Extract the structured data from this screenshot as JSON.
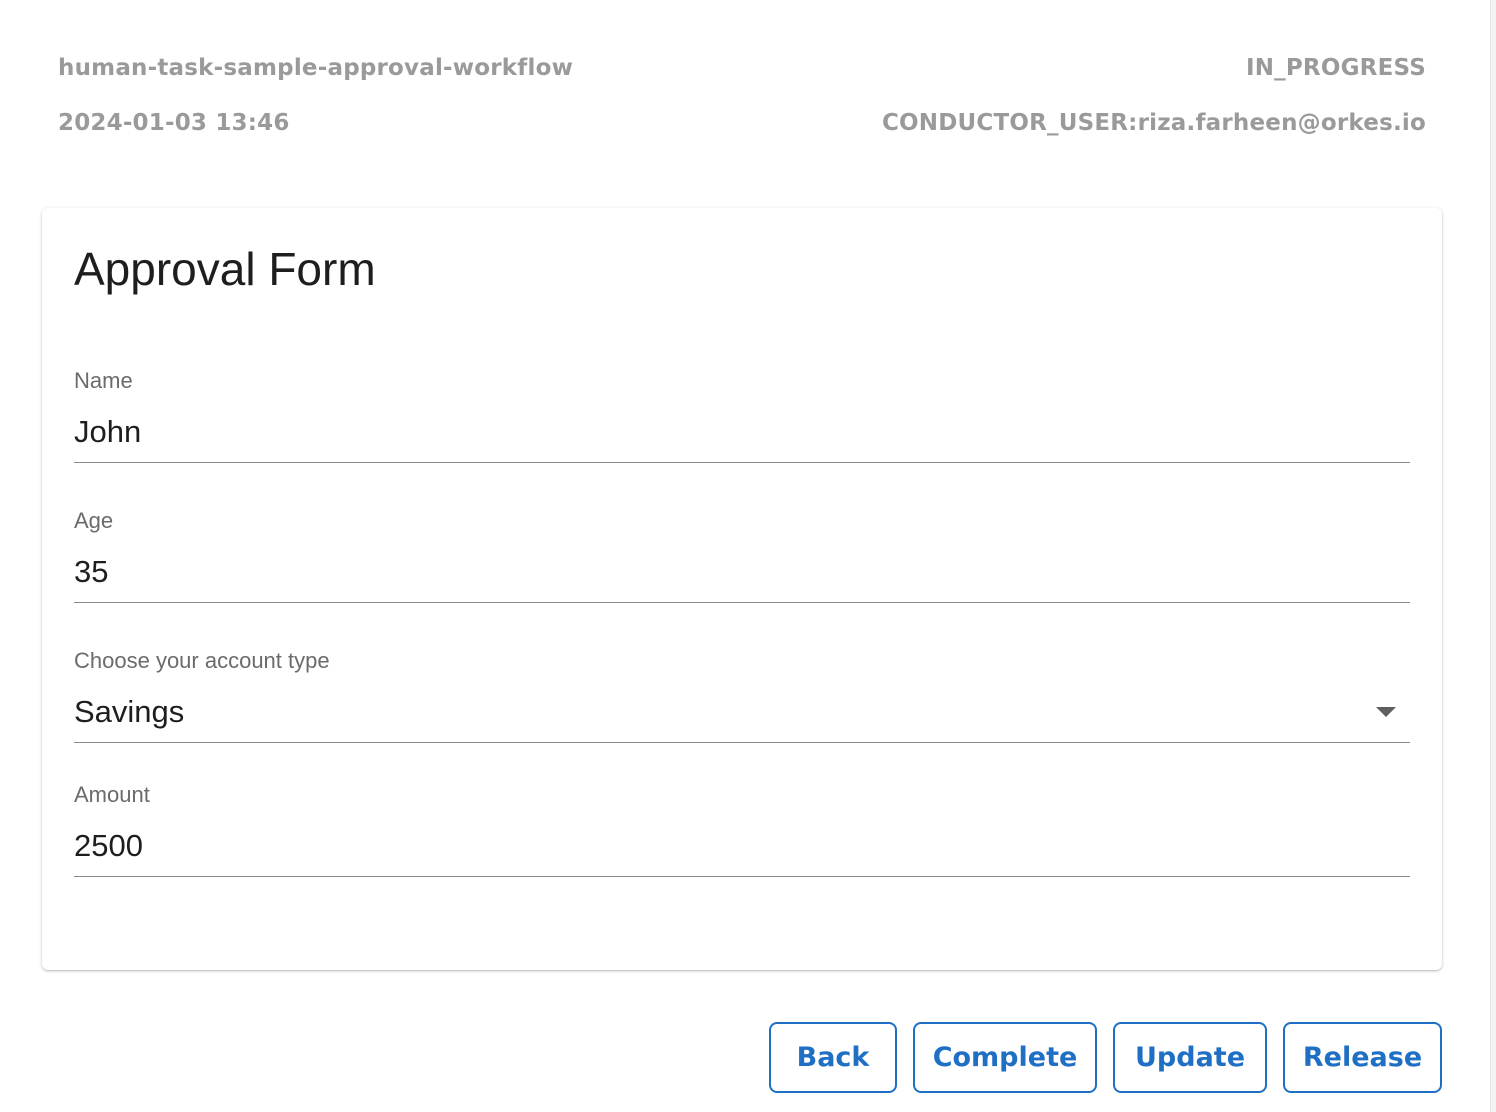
{
  "header": {
    "workflow_name": "human-task-sample-approval-workflow",
    "status": "IN_PROGRESS",
    "date": "2024-01-03 13:46",
    "user": "CONDUCTOR_USER:riza.farheen@orkes.io"
  },
  "form": {
    "title": "Approval Form",
    "fields": [
      {
        "label": "Name",
        "value": "John"
      },
      {
        "label": "Age",
        "value": "35"
      },
      {
        "label": "Choose your account type",
        "value": "Savings"
      },
      {
        "label": "Amount",
        "value": "2500"
      }
    ]
  },
  "actions": {
    "back_label": "Back",
    "complete_label": "Complete",
    "update_label": "Update",
    "release_label": "Release"
  },
  "colors": {
    "accent": "#1f6fc5",
    "meta_text": "#9a9a9a"
  },
  "icons": {
    "dropdown": "chevron-down-icon"
  }
}
